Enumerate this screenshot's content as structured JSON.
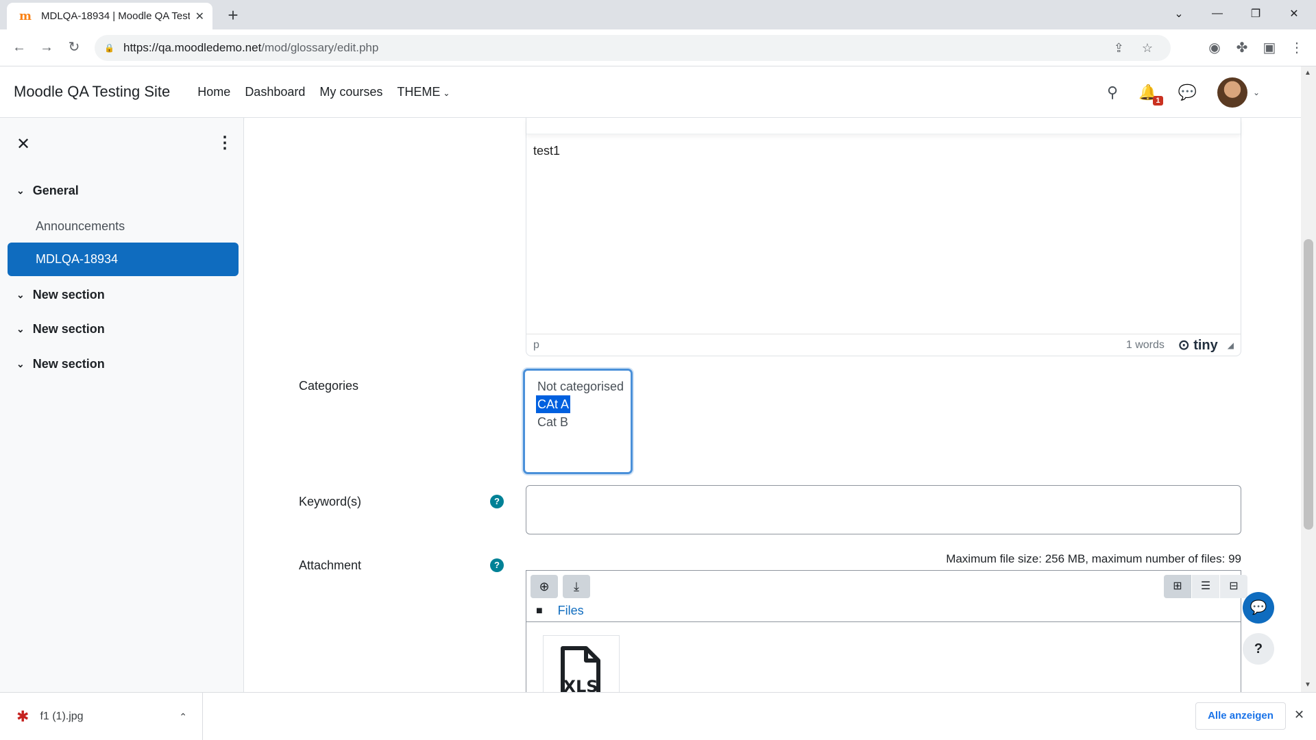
{
  "browser": {
    "tab_title": "MDLQA-18934 | Moodle QA Testi",
    "new_tab": "+",
    "url_host": "https://qa.moodledemo.net",
    "url_path": "/mod/glossary/edit.php"
  },
  "navbar": {
    "brand": "Moodle QA Testing Site",
    "links": [
      "Home",
      "Dashboard",
      "My courses",
      "THEME"
    ],
    "notification_count": "1"
  },
  "drawer": {
    "sections": [
      {
        "label": "General"
      },
      {
        "label": "New section"
      },
      {
        "label": "New section"
      },
      {
        "label": "New section"
      }
    ],
    "activities": [
      "Announcements",
      "MDLQA-18934"
    ]
  },
  "editor": {
    "content": "test1",
    "status_path": "p",
    "word_count": "1 words",
    "brand": "tiny"
  },
  "form": {
    "categories_label": "Categories",
    "categories": [
      "Not categorised",
      "CAt A",
      "Cat B"
    ],
    "selected_category": "CAt A",
    "keywords_label": "Keyword(s)",
    "attachment_label": "Attachment",
    "max_file_info": "Maximum file size: 256 MB, maximum number of files: 99",
    "files_path": "Files",
    "file_type_label": "XLS"
  },
  "float": {
    "help": "?"
  },
  "downloads": {
    "file_name": "f1 (1).jpg",
    "show_all": "Alle anzeigen"
  }
}
